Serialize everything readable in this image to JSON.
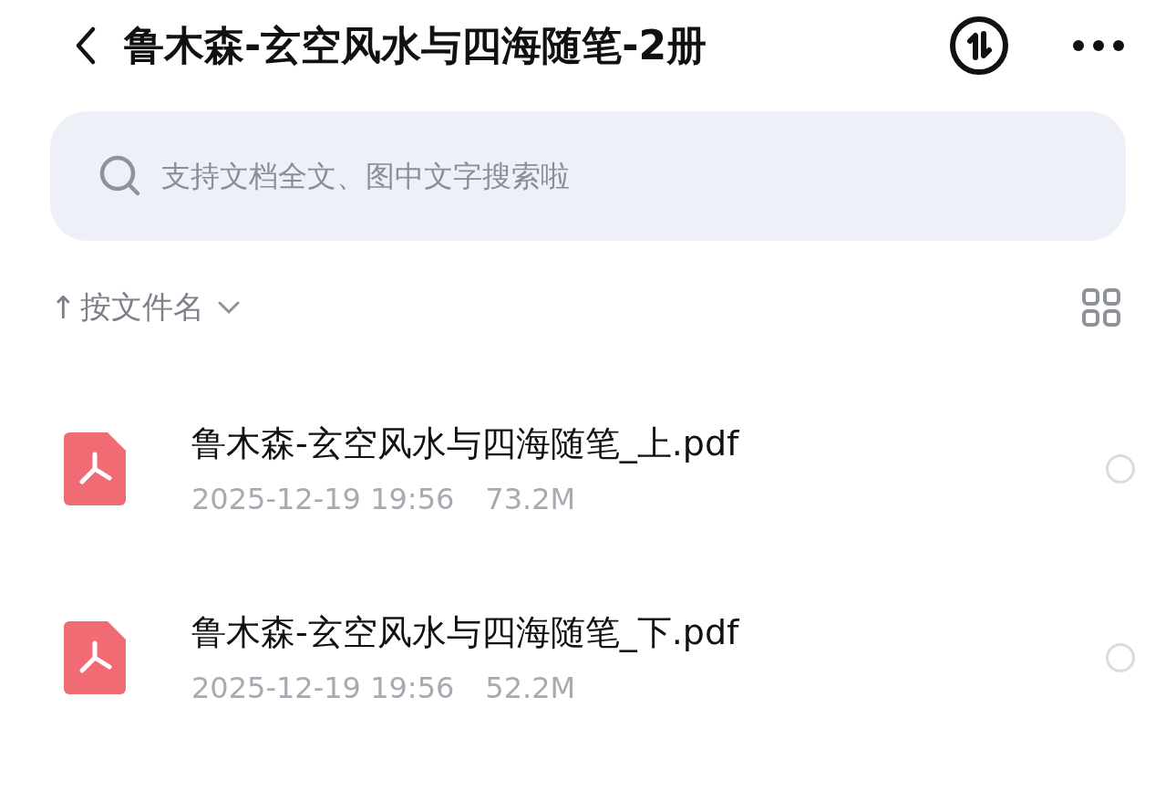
{
  "header": {
    "title": "鲁木森-玄空风水与四海随笔-2册"
  },
  "search": {
    "placeholder": "支持文档全文、图中文字搜索啦"
  },
  "sort": {
    "arrow": "↑",
    "label": "按文件名"
  },
  "files": [
    {
      "kind": "pdf",
      "name": "鲁木森-玄空风水与四海随笔_上.pdf",
      "date": "2025-12-19 19:56",
      "size": "73.2M",
      "selected": false
    },
    {
      "kind": "pdf",
      "name": "鲁木森-玄空风水与四海随笔_下.pdf",
      "date": "2025-12-19 19:56",
      "size": "52.2M",
      "selected": false
    }
  ]
}
